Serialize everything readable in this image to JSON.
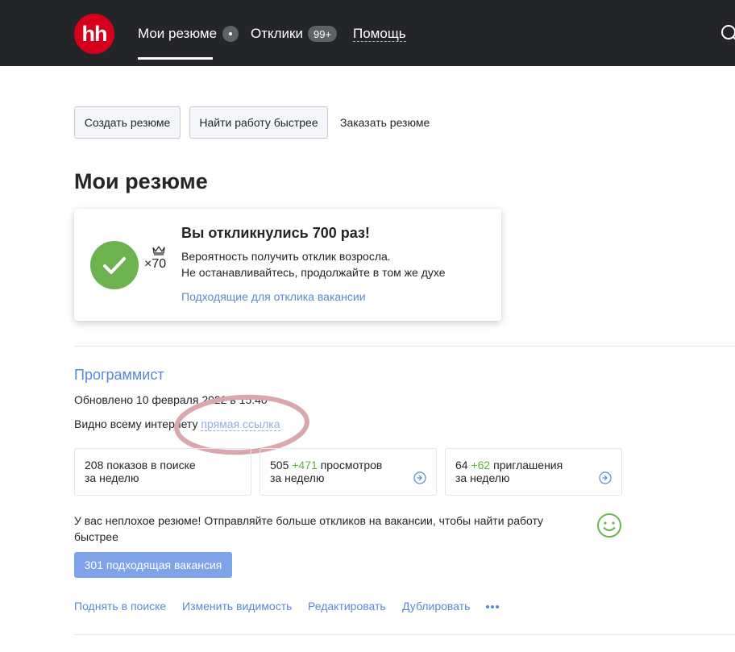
{
  "header": {
    "logo_text": "hh",
    "nav": {
      "resumes": "Мои резюме",
      "responses": "Отклики",
      "responses_count": "99+",
      "help": "Помощь"
    }
  },
  "actions_top": {
    "create": "Создать резюме",
    "find": "Найти работу быстрее",
    "order": "Заказать резюме"
  },
  "page_title": "Мои резюме",
  "achievement": {
    "title": "Вы откликнулись 700 раз!",
    "multiplier": "×70",
    "line1": "Вероятность получить отклик возросла.",
    "line2": "Не останавливайтесь, продолжайте в том же духе",
    "link": "Подходящие для отклика вакансии"
  },
  "resume": {
    "title": "Программист",
    "updated": "Обновлено 10 февраля 2022 в 15:40",
    "visibility_label": "Видно всему интернету",
    "visibility_link": "прямая ссылка",
    "stats": {
      "views_search": "208 показов в поиске",
      "views_search_period": "за неделю",
      "views_count": "505",
      "views_delta": "+471",
      "views_label": "просмотров",
      "views_period": "за неделю",
      "invites_count": "64",
      "invites_delta": "+62",
      "invites_label": "приглашения",
      "invites_period": "за неделю"
    },
    "tip": "У вас неплохое резюме! Отправляйте больше откликов на вакансии, чтобы найти работу быстрее",
    "vacancies_button": "301 подходящая вакансия",
    "actions": {
      "raise": "Поднять в поиске",
      "visibility": "Изменить видимость",
      "edit": "Редактировать",
      "duplicate": "Дублировать"
    }
  },
  "colors": {
    "header_bg": "#232529",
    "logo_red": "#d6001c",
    "link_blue": "#5989d6",
    "success_green": "#6cb24f",
    "button_blue": "#7fa3e8",
    "highlight_ring": "#d9a7ad"
  }
}
